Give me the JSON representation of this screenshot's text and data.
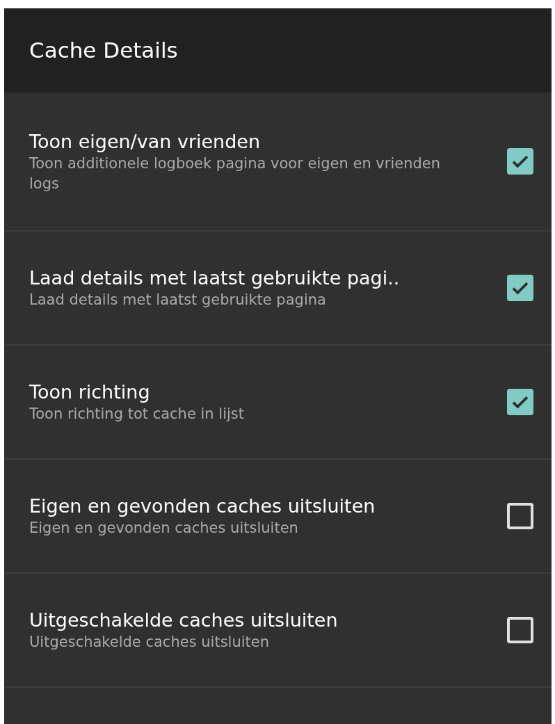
{
  "app_bar": {
    "title": "Cache Details"
  },
  "settings": [
    {
      "title": "Toon eigen/van vrienden",
      "summary": "Toon additionele logboek pagina voor eigen en vrienden logs",
      "checked": true
    },
    {
      "title": "Laad details met laatst gebruikte pagi..",
      "summary": "Laad details met laatst gebruikte pagina",
      "checked": true
    },
    {
      "title": "Toon richting",
      "summary": "Toon richting tot cache in lijst",
      "checked": true
    },
    {
      "title": "Eigen en gevonden caches uitsluiten",
      "summary": "Eigen en gevonden caches uitsluiten",
      "checked": false
    },
    {
      "title": "Uitgeschakelde caches uitsluiten",
      "summary": "Uitgeschakelde caches uitsluiten",
      "checked": false
    }
  ]
}
